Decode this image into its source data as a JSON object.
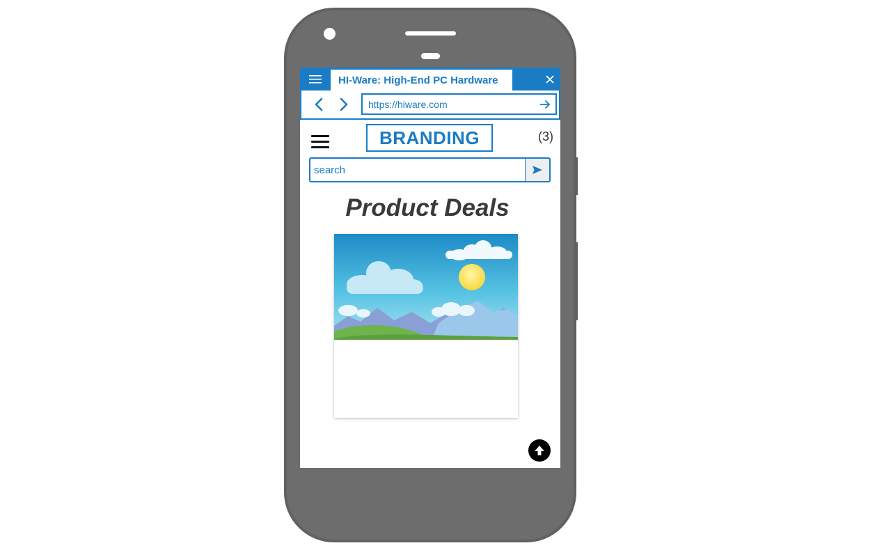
{
  "browser": {
    "tab_title": "HI-Ware: High-End PC Hardware",
    "url": "https://hiware.com",
    "icons": {
      "tabs_menu": "menu-icon",
      "close": "close-icon",
      "back": "chevron-left-icon",
      "forward": "chevron-right-icon",
      "go": "arrow-right-icon"
    }
  },
  "site": {
    "menu_icon": "hamburger-icon",
    "branding": "BRANDING",
    "cart_count": "(3)",
    "search": {
      "placeholder": "search",
      "button_icon": "send-icon"
    },
    "heading": "Product Deals",
    "product_image": "landscape-image-placeholder",
    "scroll_top_icon": "arrow-up-icon"
  },
  "colors": {
    "accent": "#1a7cc5",
    "phone_body": "#6d6d6d",
    "heading_text": "#3a3a3a"
  }
}
